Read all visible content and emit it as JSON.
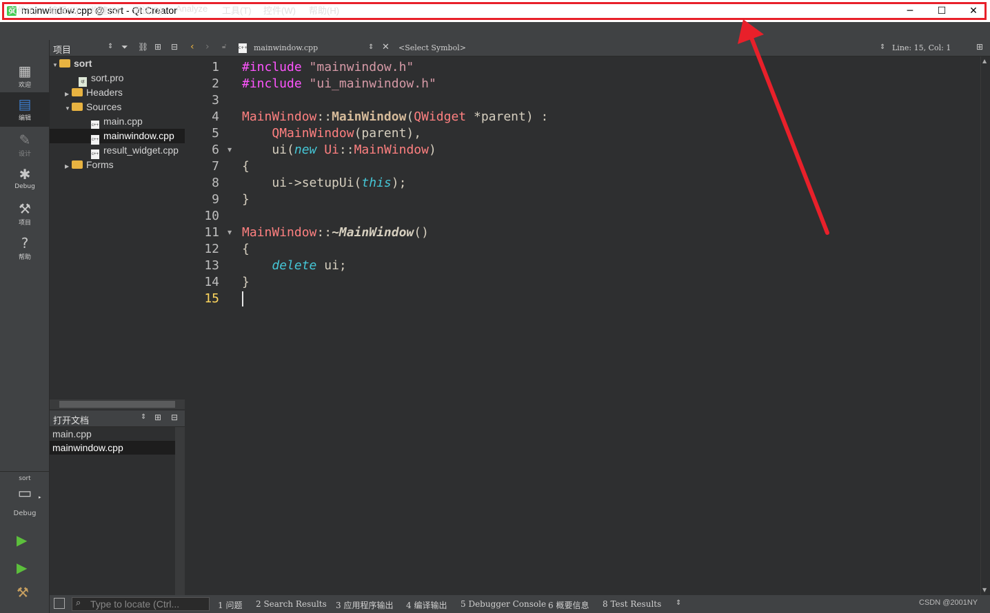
{
  "window": {
    "title": "mainwindow.cpp @ sort - Qt Creator",
    "app_icon": "qt-logo-icon",
    "highlight_color": "#e8202a"
  },
  "menu": [
    "文件(F)",
    "编辑(E)",
    "构建(B)",
    "调试(D)",
    "Analyze",
    "工具(T)",
    "控件(W)",
    "帮助(H)"
  ],
  "modes": [
    {
      "label": "欢迎",
      "icon": "grid-icon"
    },
    {
      "label": "编辑",
      "icon": "document-icon"
    },
    {
      "label": "设计",
      "icon": "pencil-icon"
    },
    {
      "label": "Debug",
      "icon": "bug-icon"
    },
    {
      "label": "项目",
      "icon": "wrench-icon"
    },
    {
      "label": "帮助",
      "icon": "help-icon"
    }
  ],
  "kit": {
    "project": "sort",
    "config": "Debug"
  },
  "project_panel": {
    "header": "项目",
    "tree": [
      {
        "label": "sort",
        "level": 0,
        "kind": "project",
        "expanded": true
      },
      {
        "label": "sort.pro",
        "level": 1,
        "kind": "pro"
      },
      {
        "label": "Headers",
        "level": 1,
        "kind": "folder",
        "expanded": false
      },
      {
        "label": "Sources",
        "level": 1,
        "kind": "folder",
        "expanded": true
      },
      {
        "label": "main.cpp",
        "level": 2,
        "kind": "file"
      },
      {
        "label": "mainwindow.cpp",
        "level": 2,
        "kind": "file",
        "selected": true
      },
      {
        "label": "result_widget.cpp",
        "level": 2,
        "kind": "file"
      },
      {
        "label": "Forms",
        "level": 1,
        "kind": "folder",
        "expanded": false
      }
    ]
  },
  "open_docs": {
    "header": "打开文档",
    "items": [
      "main.cpp",
      "mainwindow.cpp"
    ]
  },
  "editor_toolbar": {
    "file": "mainwindow.cpp",
    "symbol": "<Select Symbol>",
    "position": "Line: 15, Col: 1"
  },
  "editor": {
    "current_line": 15,
    "lines": [
      "#include \"mainwindow.h\"",
      "#include \"ui_mainwindow.h\"",
      "",
      "MainWindow::MainWindow(QWidget *parent) :",
      "    QMainWindow(parent),",
      "    ui(new Ui::MainWindow)",
      "{",
      "    ui->setupUi(this);",
      "}",
      "",
      "MainWindow::~MainWindow()",
      "{",
      "    delete ui;",
      "}",
      ""
    ]
  },
  "locator_placeholder": "Type to locate (Ctrl...",
  "output_tabs": [
    "1  问题",
    "2  Search Results",
    "3  应用程序输出",
    "4  编译输出",
    "5  Debugger Console",
    "6  概要信息",
    "8  Test Results"
  ],
  "watermark": "CSDN @2001NY"
}
